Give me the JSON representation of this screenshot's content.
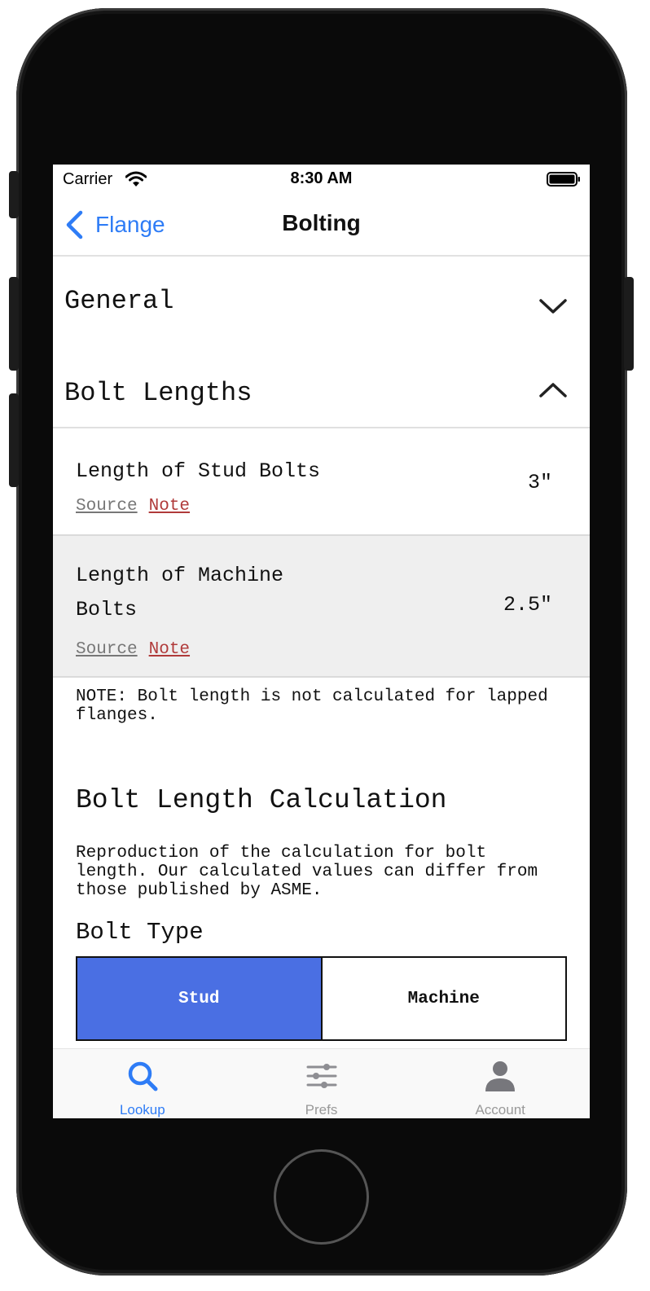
{
  "status_bar": {
    "carrier": "Carrier",
    "time": "8:30 AM",
    "wifi_icon": "wifi-icon",
    "battery_icon": "battery-icon"
  },
  "nav": {
    "back_label": "Flange",
    "title": "Bolting",
    "back_icon": "chevron-left-icon"
  },
  "sections": {
    "general": {
      "title": "General",
      "expanded": false,
      "icon": "chevron-down-icon"
    },
    "bolt_lengths": {
      "title": "Bolt Lengths",
      "expanded": true,
      "icon": "chevron-up-icon"
    }
  },
  "rows": [
    {
      "label": "Length of Stud Bolts",
      "value": "3\"",
      "source_label": "Source",
      "note_label": "Note"
    },
    {
      "label": "Length of Machine Bolts",
      "value": "2.5\"",
      "source_label": "Source",
      "note_label": "Note"
    }
  ],
  "note": "NOTE: Bolt length is not calculated for lapped flanges.",
  "calculation": {
    "heading": "Bolt Length Calculation",
    "description": "Reproduction of the calculation for bolt length. Our calculated values can differ from those published by ASME.",
    "bolt_type_label": "Bolt Type",
    "options": [
      "Stud",
      "Machine"
    ],
    "selected": "Stud"
  },
  "tabs": [
    {
      "label": "Lookup",
      "icon": "search-icon",
      "active": true
    },
    {
      "label": "Prefs",
      "icon": "sliders-icon",
      "active": false
    },
    {
      "label": "Account",
      "icon": "person-icon",
      "active": false
    }
  ],
  "colors": {
    "accent": "#2e7cf6",
    "segment_selected": "#4a6fe3",
    "note_link": "#b03a3a",
    "row_alt_bg": "#efefef"
  }
}
